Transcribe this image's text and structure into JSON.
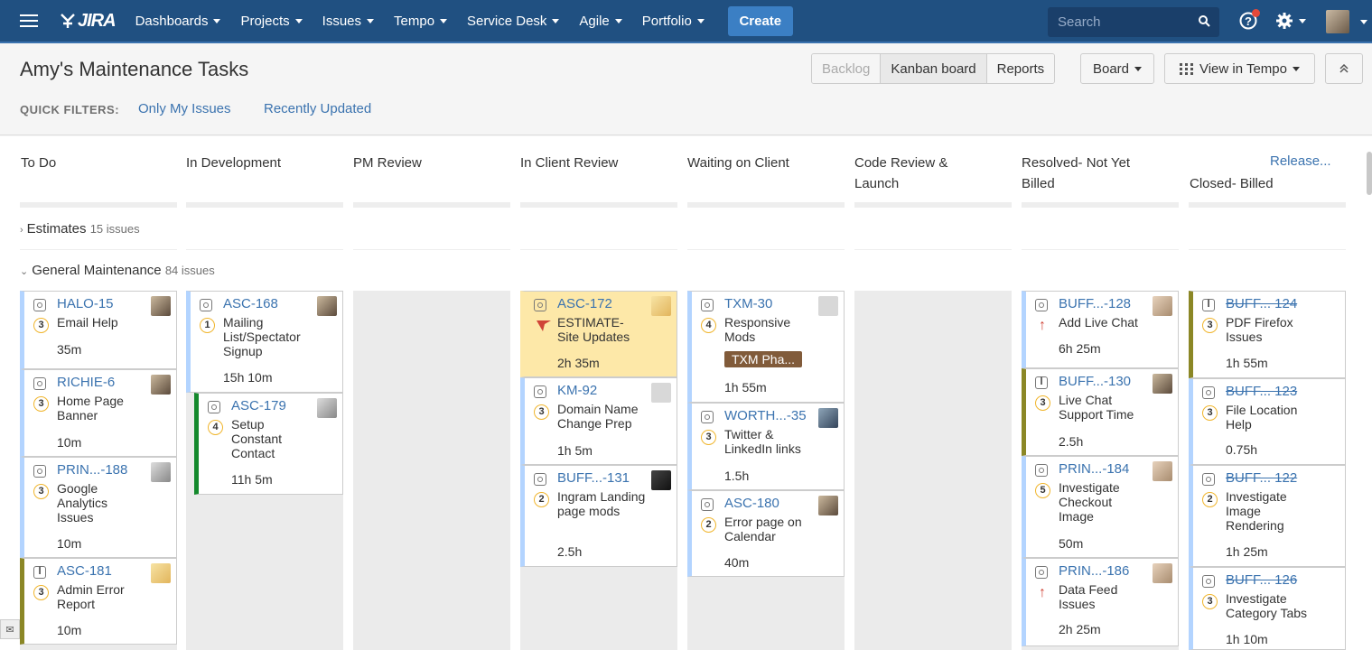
{
  "nav": {
    "logo": "JIRA",
    "items": [
      {
        "label": "Dashboards"
      },
      {
        "label": "Projects"
      },
      {
        "label": "Issues"
      },
      {
        "label": "Tempo"
      },
      {
        "label": "Service Desk"
      },
      {
        "label": "Agile"
      },
      {
        "label": "Portfolio"
      }
    ],
    "create": "Create",
    "search_placeholder": "Search"
  },
  "header": {
    "title": "Amy's Maintenance Tasks",
    "quick_filters_label": "QUICK FILTERS:",
    "filters": [
      "Only My Issues",
      "Recently Updated"
    ],
    "buttons": {
      "backlog": "Backlog",
      "kanban": "Kanban board",
      "reports": "Reports",
      "board": "Board",
      "tempo": "View in Tempo"
    }
  },
  "columns": [
    {
      "name": "To Do"
    },
    {
      "name": "In Development"
    },
    {
      "name": "PM Review"
    },
    {
      "name": "In Client Review"
    },
    {
      "name": "Waiting on Client"
    },
    {
      "name": "Code Review & Launch"
    },
    {
      "name": "Resolved- Not Yet Billed"
    },
    {
      "name": "Closed- Billed"
    }
  ],
  "release_link": "Release...",
  "swimlanes": [
    {
      "name": "Estimates",
      "count": "15 issues"
    },
    {
      "name": "General Maintenance",
      "count": "84 issues"
    }
  ],
  "cards": {
    "c1": {
      "key": "HALO-15",
      "summary": "Email Help",
      "priority": "3",
      "estimate": "35m"
    },
    "c2": {
      "key": "RICHIE-6",
      "summary": "Home Page Banner",
      "priority": "3",
      "estimate": "10m"
    },
    "c3": {
      "key": "PRIN...-188",
      "summary": "Google Analytics Issues",
      "priority": "3",
      "estimate": "10m"
    },
    "c4": {
      "key": "ASC-181",
      "summary": "Admin Error Report",
      "priority": "3",
      "estimate": "10m"
    },
    "c5": {
      "key": "ASC-168",
      "summary": "Mailing List/Spectator Signup",
      "priority": "1",
      "estimate": "15h 10m"
    },
    "c6": {
      "key": "ASC-179",
      "summary": "Setup Constant Contact",
      "priority": "4",
      "estimate": "11h 5m"
    },
    "c7": {
      "key": "ASC-172",
      "summary": "ESTIMATE- Site Updates",
      "estimate": "2h 35m"
    },
    "c8": {
      "key": "KM-92",
      "summary": "Domain Name Change Prep",
      "priority": "3",
      "estimate": "1h 5m"
    },
    "c9": {
      "key": "BUFF...-131",
      "summary": "Ingram Landing page mods",
      "priority": "2",
      "estimate": "2.5h"
    },
    "c10": {
      "key": "TXM-30",
      "summary": "Responsive Mods",
      "priority": "4",
      "epic": "TXM Pha...",
      "estimate": "1h 55m"
    },
    "c11": {
      "key": "WORTH...-35",
      "summary": "Twitter & LinkedIn links",
      "priority": "3",
      "estimate": "1.5h"
    },
    "c12": {
      "key": "ASC-180",
      "summary": "Error page on Calendar",
      "priority": "2",
      "estimate": "40m"
    },
    "c13": {
      "key": "BUFF...-128",
      "summary": "Add Live Chat",
      "estimate": "6h 25m"
    },
    "c14": {
      "key": "BUFF...-130",
      "summary": "Live Chat Support Time",
      "priority": "3",
      "estimate": "2.5h"
    },
    "c15": {
      "key": "PRIN...-184",
      "summary": "Investigate Checkout Image",
      "priority": "5",
      "estimate": "50m"
    },
    "c16": {
      "key": "PRIN...-186",
      "summary": "Data Feed Issues",
      "estimate": "2h 25m"
    },
    "c17": {
      "key": "BUFF... 124",
      "summary": "PDF Firefox Issues",
      "priority": "3",
      "estimate": "1h 55m"
    },
    "c18": {
      "key": "BUFF... 123",
      "summary": "File Location Help",
      "priority": "3",
      "estimate": "0.75h"
    },
    "c19": {
      "key": "BUFF... 122",
      "summary": "Investigate Image Rendering",
      "priority": "2",
      "estimate": "1h 25m"
    },
    "c20": {
      "key": "BUFF... 126",
      "summary": "Investigate Category Tabs",
      "priority": "3",
      "estimate": "1h 10m"
    }
  },
  "colors": {
    "nav": "#205081",
    "link": "#3b73af",
    "highlight": "#fde8a8",
    "epic": "#815b3a"
  }
}
